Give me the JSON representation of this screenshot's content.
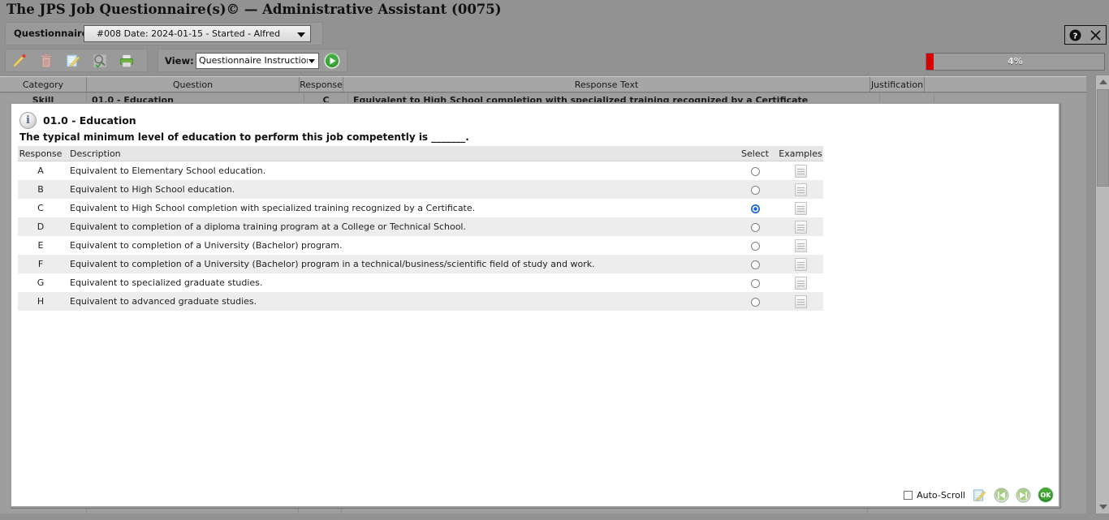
{
  "window": {
    "title": "The JPS Job Questionnaire(s)© — Administrative Assistant (0075)",
    "help_label": "?",
    "close_label": "×"
  },
  "questionnaire_bar": {
    "label": "Questionnaire:",
    "selected": "#008 Date: 2024-01-15 - Started - Alfred"
  },
  "toolbar": {
    "icons": [
      {
        "name": "edit-pencil-icon",
        "title": "Edit"
      },
      {
        "name": "delete-trash-icon",
        "title": "Delete"
      },
      {
        "name": "notes-edit-icon",
        "title": "Notes"
      },
      {
        "name": "search-magnifier-icon",
        "title": "Search"
      },
      {
        "name": "print-icon",
        "title": "Print"
      }
    ],
    "view_label": "View:",
    "view_selected": "Questionnaire Instructions",
    "go_title": "Go"
  },
  "progress": {
    "percent_label": "4%",
    "percent_value": 4,
    "fill_color": "#d90000"
  },
  "grid": {
    "headers": [
      "Category",
      "Question",
      "Response",
      "Response Text",
      "Justification"
    ],
    "rows": [
      {
        "category": "Skill",
        "question": "01.0 - Education",
        "response": "C",
        "response_text": "Equivalent to High School completion with specialized training recognized by a Certificate",
        "justification": ""
      }
    ]
  },
  "dialog": {
    "title": "01.0 - Education",
    "info_icon": "i",
    "question": "The typical minimum level of education to perform this job competently is _______.",
    "columns": {
      "response": "Response",
      "description": "Description",
      "select": "Select",
      "examples": "Examples"
    },
    "options": [
      {
        "response": "A",
        "description": "Equivalent to Elementary School education.",
        "selected": false
      },
      {
        "response": "B",
        "description": "Equivalent to High School education.",
        "selected": false
      },
      {
        "response": "C",
        "description": "Equivalent to High School completion with specialized training recognized by a Certificate.",
        "selected": true
      },
      {
        "response": "D",
        "description": "Equivalent to completion of a diploma training program at a College or Technical School.",
        "selected": false
      },
      {
        "response": "E",
        "description": "Equivalent to completion of a University (Bachelor) program.",
        "selected": false
      },
      {
        "response": "F",
        "description": "Equivalent to completion of a University (Bachelor) program in a technical/business/scientific field of study and work.",
        "selected": false
      },
      {
        "response": "G",
        "description": "Equivalent to specialized graduate studies.",
        "selected": false
      },
      {
        "response": "H",
        "description": "Equivalent to advanced graduate studies.",
        "selected": false
      }
    ],
    "footer": {
      "auto_scroll_label": "Auto-Scroll",
      "auto_scroll_checked": false,
      "buttons": [
        {
          "name": "notes-edit-icon",
          "title": "Notes"
        },
        {
          "name": "previous-question-icon",
          "title": "Previous"
        },
        {
          "name": "next-question-icon",
          "title": "Next"
        },
        {
          "name": "ok-button-icon",
          "title": "OK"
        }
      ]
    }
  }
}
